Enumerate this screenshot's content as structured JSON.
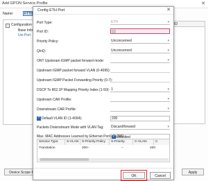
{
  "background": {
    "window_title": "Add GPON Service Profile",
    "close_glyph": "✕",
    "name_label": "Name:",
    "name_value": "FTTH",
    "tree": {
      "toggle": "−",
      "root": "Configuration",
      "child_1": "Base Info",
      "child_2": "Uni Port"
    },
    "right_header": "ID",
    "device_button": "Device Scope P",
    "apply_button": "Apply"
  },
  "dialog": {
    "title": "Config ETH Port",
    "close_glyph": "✕",
    "rows": {
      "port_type_label": "Port Type:",
      "port_type_value": "ETH",
      "port_id_label": "Port ID:",
      "priority_policy_label": "Priority Policy:",
      "priority_policy_value": "Unconcerned",
      "qinq_label": "QinQ:",
      "qinq_value": "Unconcerned",
      "ont_igmp_mode_label": "ONT Upstream IGMP packet forward mode:",
      "igmp_vlan_label": "Upstream IGMP packet forward VLAN (0-4095):",
      "igmp_priority_label": "Upstream IGMP Packet Forwarding Priority (0-7):",
      "dscp_label": "DSCP To 802.1P Mapping Priority Index (1-50):",
      "dscp_value": "1",
      "upstream_car_label": "Upstream CAR Profile:",
      "downstream_car_label": "Downstream CAR Profile:",
      "default_vlan_label": "Default VLAN ID (1-4094):",
      "default_vlan_value": "200",
      "downstream_tag_label": "Packets Downstream Mode with VLAN Tag:",
      "downstream_tag_value": "Discard/forward",
      "mac_limit_label": "Max. MAC Addresses Learned by Ethernet Ports (1-255):",
      "mac_unlimited_label": "Unlimited"
    },
    "chevron_glyph": "▾",
    "table": {
      "headers": [
        "Service Type",
        "S-VLAN",
        "S-Priority Policy",
        "S-Priority",
        "C-VLAN",
        "C"
      ],
      "row": [
        "Translation",
        "200",
        "–",
        "–",
        "200",
        ""
      ]
    },
    "ok_button": "OK",
    "cancel_button": "Cancel"
  },
  "colors": {
    "highlight": "#e02020",
    "focus_border": "#c0487a",
    "checkbox": "#2b62b0",
    "tree_selected": "#2a62b8"
  }
}
